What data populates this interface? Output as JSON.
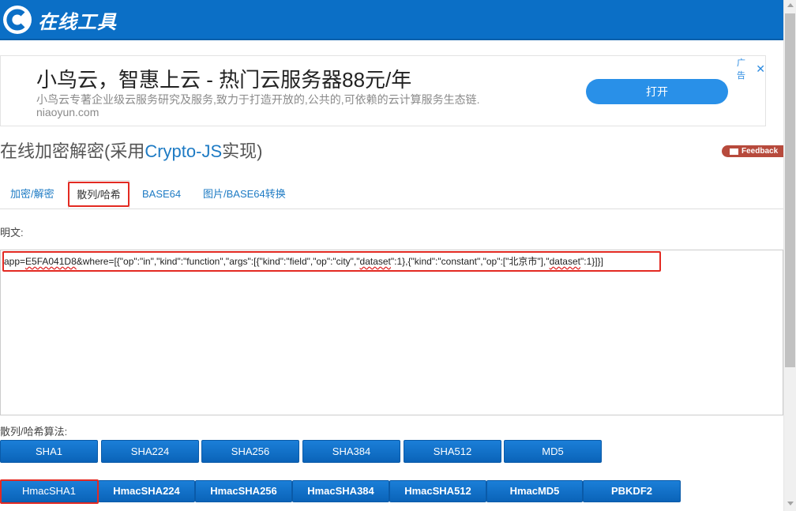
{
  "header": {
    "logo_text": "在线工具"
  },
  "ad": {
    "title": "小鸟云，智惠上云 - 热门云服务器88元/年",
    "desc": "小鸟云专著企业级云服务研究及服务,致力于打造开放的,公共的,可依赖的云计算服务生态链.",
    "url": "niaoyun.com",
    "button": "打开",
    "badge": "广告",
    "close": "✕"
  },
  "title": {
    "prefix": "在线加密解密(采用",
    "em": "Crypto-JS",
    "suffix": "实现)"
  },
  "feedback": "Feedback",
  "tabs": [
    {
      "label": "加密/解密"
    },
    {
      "label": "散列/哈希"
    },
    {
      "label": "BASE64"
    },
    {
      "label": "图片/BASE64转换"
    }
  ],
  "plaintext_label": "明文:",
  "plaintext": {
    "p1": "app=",
    "p2": "E5FA041D8",
    "p3": "&where=[{\"op\":\"in\",\"kind\":\"function\",\"args\":[{\"kind\":\"field\",\"op\":\"city\",\"",
    "p4": "dataset",
    "p5": "\":1},{\"kind\":\"constant\",\"op\":[\"北京市\"],\"",
    "p6": "dataset",
    "p7": "\":1}]}]"
  },
  "algo_label": "散列/哈希算法:",
  "hash_buttons": [
    "SHA1",
    "SHA224",
    "SHA256",
    "SHA384",
    "SHA512",
    "MD5"
  ],
  "hmac_buttons": [
    "HmacSHA1",
    "HmacSHA224",
    "HmacSHA256",
    "HmacSHA384",
    "HmacSHA512",
    "HmacMD5",
    "PBKDF2"
  ],
  "colors": {
    "brand": "#0b6fc6",
    "button": "#0a63b8",
    "highlight": "#e32a22",
    "link": "#1e7bc4"
  }
}
